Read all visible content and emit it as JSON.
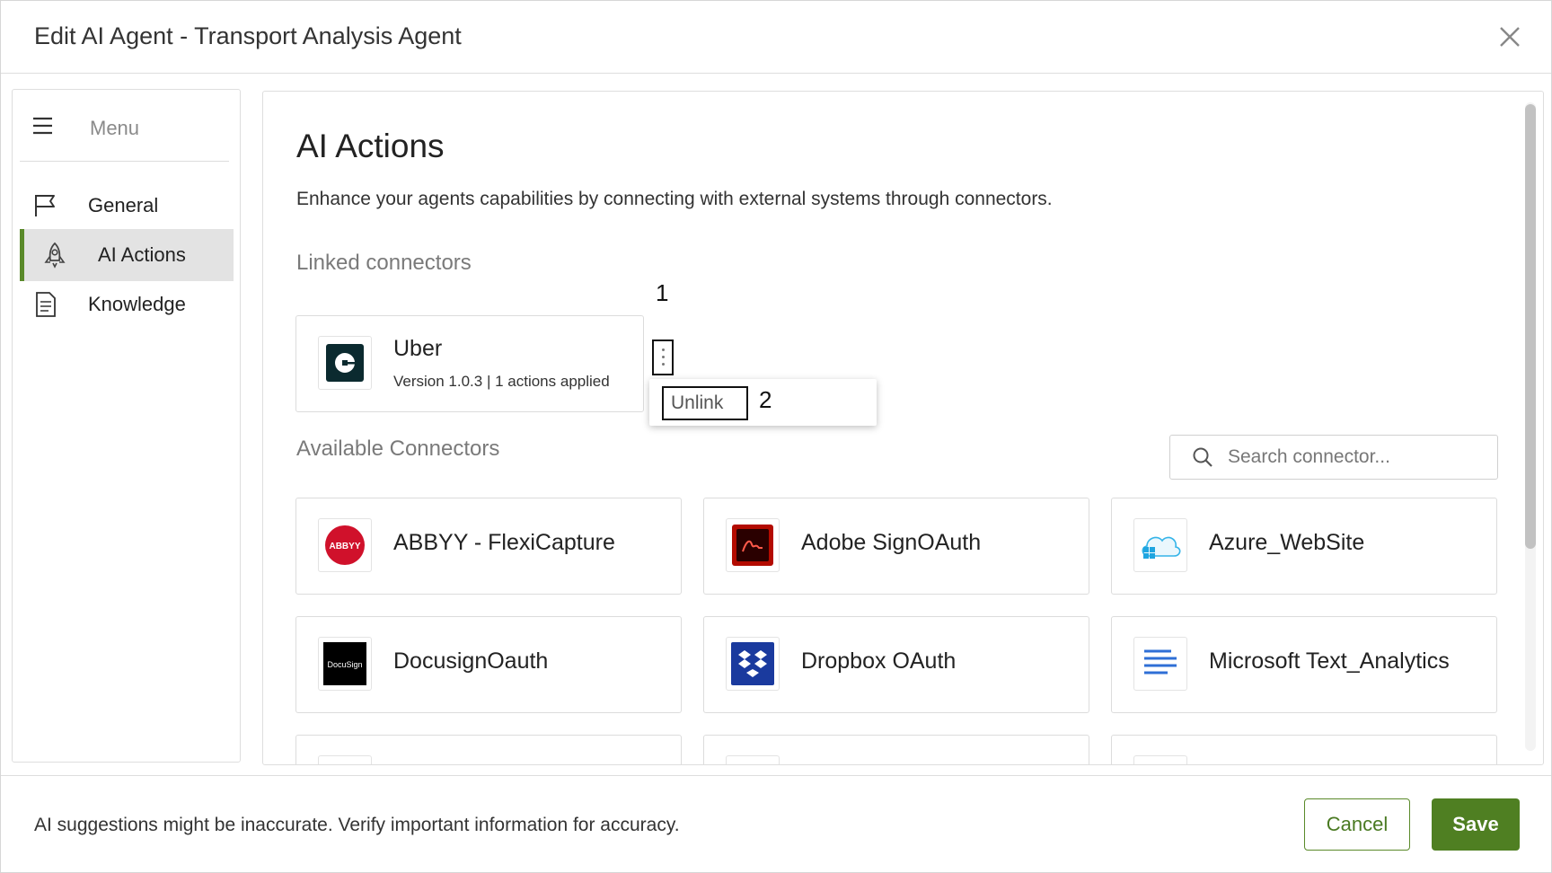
{
  "header": {
    "title": "Edit AI Agent - Transport Analysis Agent"
  },
  "sidebar": {
    "menu_label": "Menu",
    "items": [
      {
        "label": "General",
        "icon": "flag-icon"
      },
      {
        "label": "AI Actions",
        "icon": "rocket-icon",
        "active": true
      },
      {
        "label": "Knowledge",
        "icon": "document-icon"
      }
    ]
  },
  "main": {
    "title": "AI Actions",
    "description": "Enhance your agents capabilities by connecting with external systems through connectors.",
    "linked_title": "Linked connectors",
    "linked": [
      {
        "name": "Uber",
        "meta": "Version 1.0.3 | 1 actions applied"
      }
    ],
    "menu": {
      "unlink_label": "Unlink"
    },
    "markers": [
      "1",
      "2"
    ],
    "available_title": "Available Connectors",
    "search": {
      "placeholder": "Search connector..."
    },
    "connectors": [
      {
        "name": "ABBYY - FlexiCapture",
        "logo_text": "ABBYY",
        "color": "#d0112b"
      },
      {
        "name": "Adobe SignOAuth",
        "logo_text": "",
        "color": "#b30b00"
      },
      {
        "name": "Azure_WebSite",
        "logo_text": "",
        "color": "#35b4e8"
      },
      {
        "name": "DocusignOauth",
        "logo_text": "DocuSign",
        "color": "#000000"
      },
      {
        "name": "Dropbox OAuth",
        "logo_text": "",
        "color": "#1a3a9e"
      },
      {
        "name": "Microsoft Text_Analytics",
        "logo_text": "",
        "color": "#2f6fd6"
      }
    ]
  },
  "footer": {
    "note": "AI suggestions might be inaccurate. Verify important information for accuracy.",
    "cancel_label": "Cancel",
    "save_label": "Save"
  },
  "colors": {
    "accent": "#4f7f22",
    "active_bar": "#5a8a2a"
  }
}
